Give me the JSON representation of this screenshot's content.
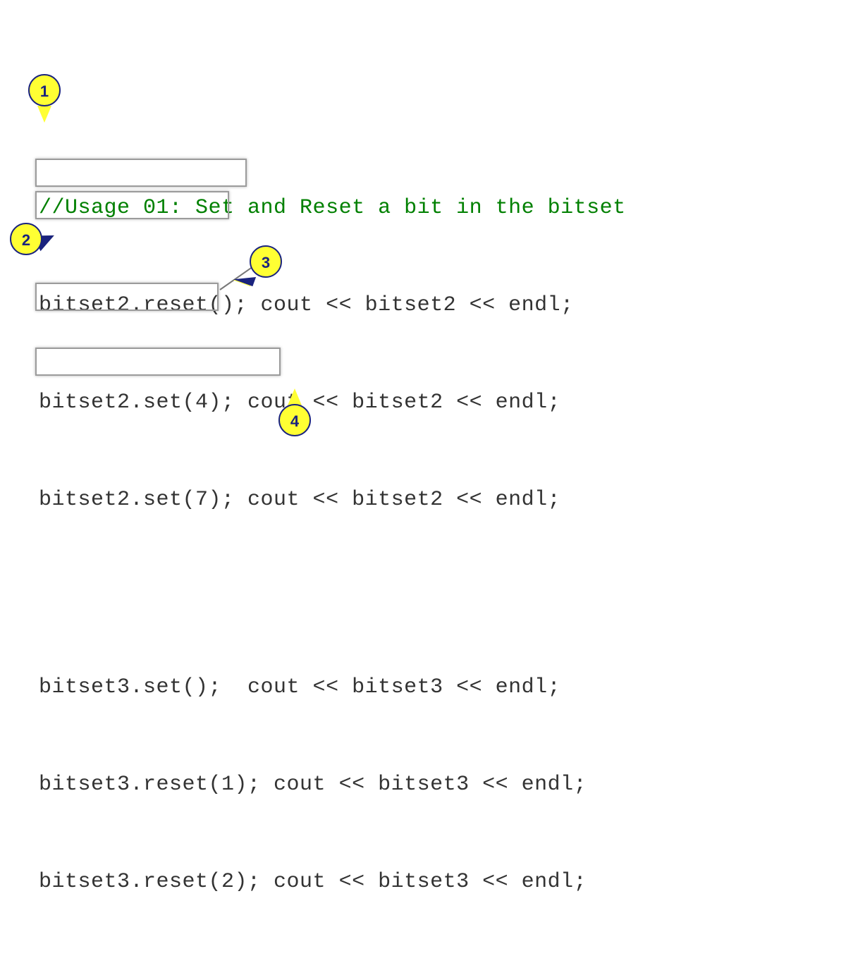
{
  "code": {
    "comment": "//Usage 01: Set and Reset a bit in the bitset",
    "line1": "bitset2.reset(); cout << bitset2 << endl;",
    "line2": "bitset2.set(4); cout << bitset2 << endl;",
    "line3": "bitset2.set(7); cout << bitset2 << endl;",
    "line4": "bitset3.set();  cout << bitset3 << endl;",
    "line5": "bitset3.reset(1); cout << bitset3 << endl;",
    "line6": "bitset3.reset(2); cout << bitset3 << endl;"
  },
  "callouts": {
    "c1": "1",
    "c2": "2",
    "c3": "3",
    "c4": "4"
  }
}
